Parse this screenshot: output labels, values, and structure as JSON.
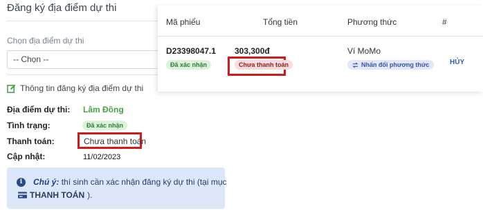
{
  "left": {
    "title": "Đăng ký địa điểm dự thi",
    "choose_label": "Chọn địa điểm dự thi",
    "select_value": "-- Chọn --",
    "info_header": "Thông tin đăng ký địa điểm dự thi",
    "rows": {
      "location_label": "Địa điểm dự thi:",
      "location_value": "Lâm Đồng",
      "status_label": "Tình trạng:",
      "status_value": "Đã xác nhận",
      "payment_label": "Thanh toán:",
      "payment_value": "Chưa thanh toán",
      "updated_label": "Cập nhật:",
      "updated_value": "11/02/2023"
    },
    "note": {
      "prefix": "Chú ý:",
      "text1": "thí sinh cần xác nhận đăng ký dự thi (tại mục",
      "link": "THANH TOÁN",
      "text2": ")."
    }
  },
  "table": {
    "headers": [
      "Mã phiếu",
      "Tổng tiền",
      "Phương thức",
      "#"
    ],
    "row": {
      "code": "D23398047.1",
      "code_badge": "Đã xác nhận",
      "amount": "303,300đ",
      "amount_badge": "Chưa thanh toán",
      "method": "Ví MoMo",
      "change_button": "Nhấn đổi phương thức",
      "cancel": "HỦY"
    }
  },
  "colors": {
    "highlight": "#d11a1a",
    "success": "#47a247",
    "link": "#2b5fb4",
    "note_bg": "#dce7fa"
  }
}
